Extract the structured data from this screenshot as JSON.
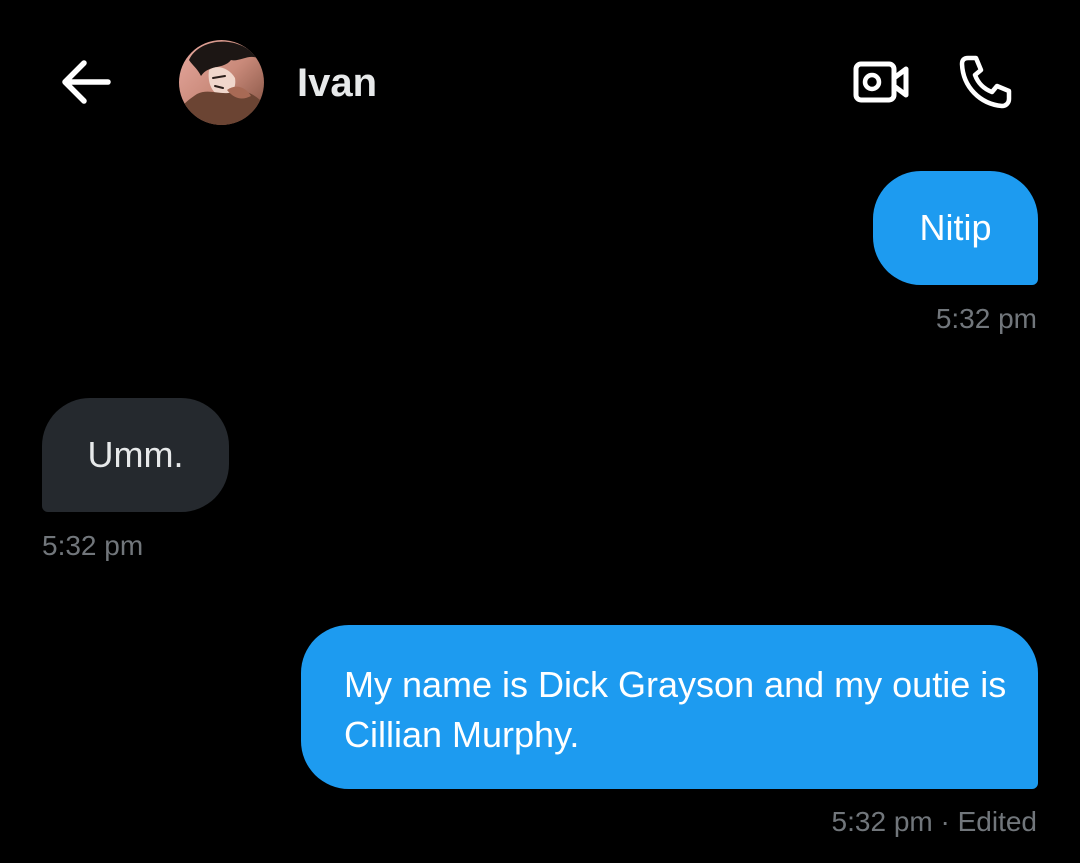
{
  "header": {
    "back_icon": "arrow-left-icon",
    "contact_name": "Ivan",
    "video_icon": "video-camera-icon",
    "call_icon": "phone-icon"
  },
  "messages": [
    {
      "direction": "sent",
      "text": "Nitip",
      "time": "5:32 pm"
    },
    {
      "direction": "received",
      "text": "Umm.",
      "time": "5:32 pm"
    },
    {
      "direction": "sent",
      "text": "My name is Dick Grayson and my outie is Cillian Murphy.",
      "time": "5:32 pm · Edited"
    }
  ],
  "colors": {
    "background": "#000000",
    "sent_bubble": "#1d9bf0",
    "received_bubble": "#25292e",
    "timestamp": "#71767b",
    "text": "#e7e9ea"
  }
}
